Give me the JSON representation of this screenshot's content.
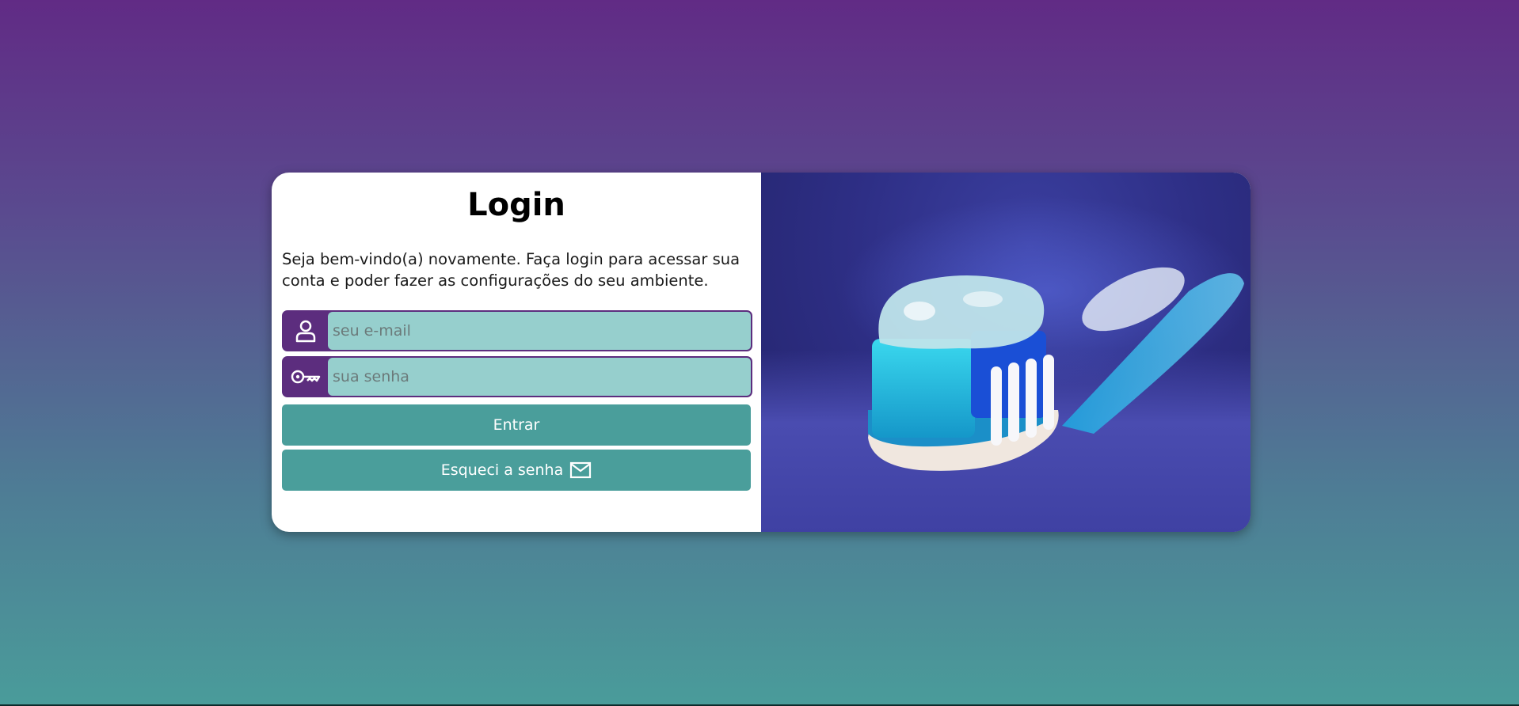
{
  "login": {
    "title": "Login",
    "intro": "Seja bem-vindo(a) novamente. Faça login para acessar sua conta e poder fazer as configurações do seu ambiente.",
    "email_placeholder": "seu e-mail",
    "password_placeholder": "sua senha",
    "submit_label": "Entrar",
    "forgot_label": "Esqueci a senha"
  },
  "icons": {
    "email_field": "user-icon",
    "password_field": "key-icon",
    "forgot": "mail-icon"
  },
  "colors": {
    "accent_purple": "#5c2d7e",
    "input_bg": "#96cfcd",
    "button_bg": "#4a9e9b"
  }
}
